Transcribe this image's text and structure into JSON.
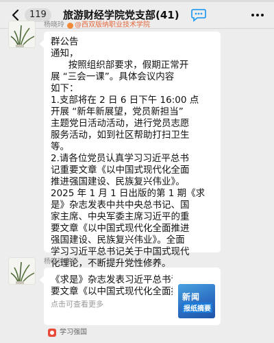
{
  "header": {
    "unread_count": "119",
    "title": "旅游财经学院党支部(41)",
    "icons": [
      "chevron-left-icon",
      "voice-bubble-icon",
      "more-icon"
    ]
  },
  "messages": [
    {
      "sender": "杨晓玲",
      "org_badge": "@西双版纳职业技术学院",
      "lines": [
        "群公告",
        "通知，",
        "      按照组织部要求，假期正常开",
        "展 “三会一课”。具体会议内容",
        "如下：",
        "1.支部将在 2 日 6 日下午 16:00 点",
        "开展 “新年新展望，党员新担当”",
        "主题党日活动活动，进行党员志愿",
        "服务活动，如到社区帮助打扫卫生",
        "等。",
        "2.请各位党员认真学习习近平总书",
        "记重要文章《以中国式现代化全面",
        "推进强国建设、民族复兴伟业》。",
        "2025 年 1 月 1 日出版的第 1 期《求",
        "是》杂志发表中共中央总书记、国",
        "家主席、中央军委主席习近平的重",
        "要文章《以中国式现代化全面推进",
        "强国建设、民族复兴伟业》。全面",
        "学习习近平总书记关于中国式现代",
        "化理论，不断提升党性修养。"
      ]
    },
    {
      "sender": "杨晓玲老师",
      "article_lines": [
        "《求是》杂志发表习近平总书记重",
        "要文章《以中国式现代化全面推..."
      ],
      "more_link": "点击可查看更多",
      "thumbnail_lines": [
        "新闻",
        "报纸摘要"
      ],
      "source": "学习强国"
    }
  ],
  "colors": {
    "background": "#ededed",
    "bubble": "#ffffff",
    "org_badge": "#e5683c",
    "source_icon": "#e84a3a",
    "thumbnail": "#2c6fc4"
  }
}
